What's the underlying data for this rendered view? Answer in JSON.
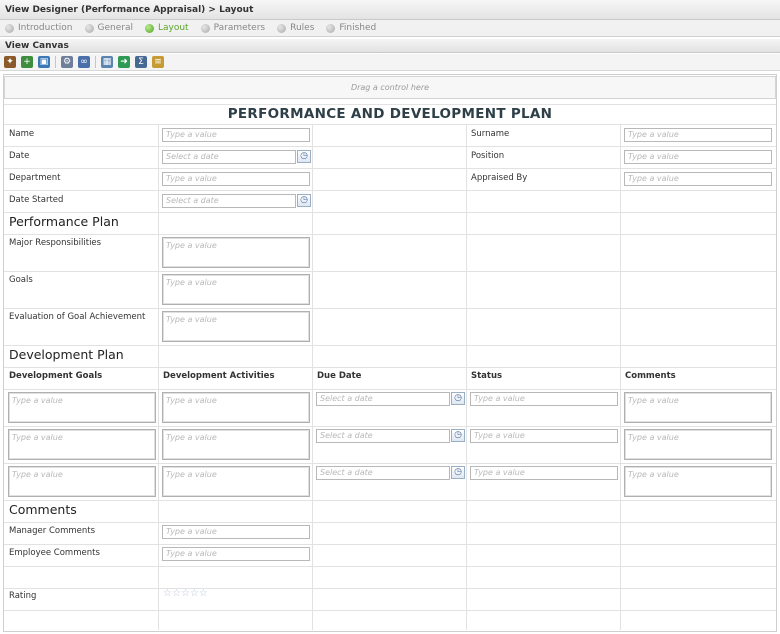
{
  "window": {
    "title": "View Designer (Performance Appraisal) > Layout"
  },
  "wizard": {
    "steps": [
      {
        "label": "Introduction",
        "active": false
      },
      {
        "label": "General",
        "active": false
      },
      {
        "label": "Layout",
        "active": true
      },
      {
        "label": "Parameters",
        "active": false
      },
      {
        "label": "Rules",
        "active": false
      },
      {
        "label": "Finished",
        "active": false
      }
    ]
  },
  "canvas": {
    "header": "View Canvas",
    "toolbar_icons": [
      "wand-icon",
      "add-table-icon",
      "image-icon",
      "gear-icon",
      "binoculars-icon",
      "table-icon",
      "import-icon",
      "sum-icon",
      "notes-icon"
    ],
    "dropzone": "Drag a control here"
  },
  "form": {
    "title": "PERFORMANCE AND DEVELOPMENT PLAN",
    "placeholders": {
      "value": "Type a value",
      "date": "Select a date"
    },
    "fields": {
      "name": "Name",
      "date": "Date",
      "department": "Department",
      "date_started": "Date Started",
      "surname": "Surname",
      "position": "Position",
      "appraised_by": "Appraised By"
    },
    "performance_plan": {
      "title": "Performance Plan",
      "fields": [
        "Major Responsibilities",
        "Goals",
        "Evaluation of Goal Achievement"
      ]
    },
    "development_plan": {
      "title": "Development Plan",
      "columns": [
        "Development Goals",
        "Development Activities",
        "Due Date",
        "Status",
        "Comments"
      ]
    },
    "comments": {
      "title": "Comments",
      "manager": "Manager Comments",
      "employee": "Employee Comments"
    },
    "rating": {
      "label": "Rating",
      "max": 5,
      "value": 0
    }
  },
  "colors": {
    "active_step": "#5aa52b",
    "title_text": "#2e3f48",
    "placeholder": "#b8b8b8"
  }
}
